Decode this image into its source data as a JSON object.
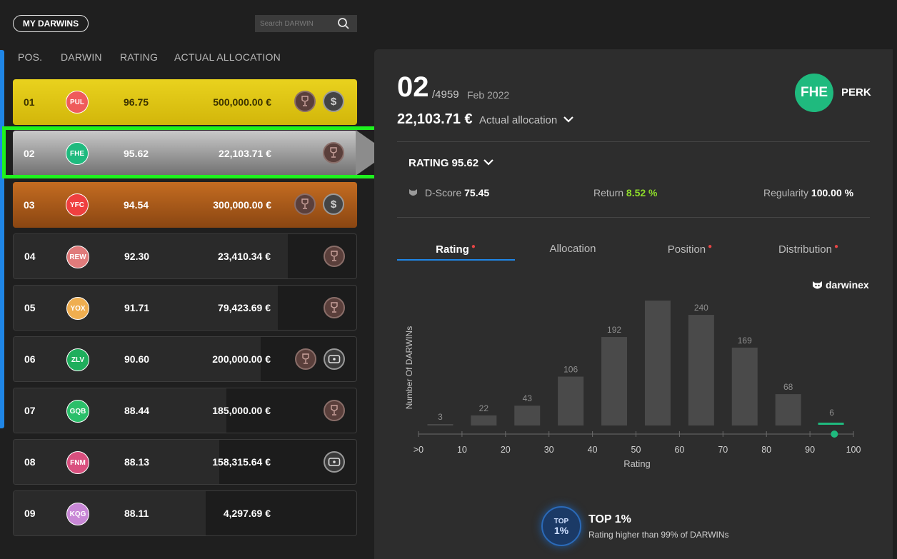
{
  "header": {
    "my_darwins_label": "MY DARWINS",
    "search_placeholder": "Search DARWIN"
  },
  "columns": [
    "POS.",
    "DARWIN",
    "RATING",
    "ACTUAL ALLOCATION"
  ],
  "rows": [
    {
      "pos": "01",
      "darwin": "PUL",
      "rating": "96.75",
      "allocation": "500,000.00 €",
      "avatar_color": "#ef5b5b",
      "alloc_fill": 1.0,
      "medals": [
        "trophy-icon",
        "dollar-icon"
      ]
    },
    {
      "pos": "02",
      "darwin": "FHE",
      "rating": "95.62",
      "allocation": "22,103.71 €",
      "avatar_color": "#1fba7e",
      "alloc_fill": 1.0,
      "medals": [
        "trophy-icon"
      ]
    },
    {
      "pos": "03",
      "darwin": "YFC",
      "rating": "94.54",
      "allocation": "300,000.00 €",
      "avatar_color": "#ef3f3f",
      "alloc_fill": 1.0,
      "medals": [
        "trophy-icon",
        "dollar-icon"
      ]
    },
    {
      "pos": "04",
      "darwin": "REW",
      "rating": "92.30",
      "allocation": "23,410.34 €",
      "avatar_color": "#e07b7b",
      "alloc_fill": 0.8,
      "medals": [
        "trophy-icon"
      ]
    },
    {
      "pos": "05",
      "darwin": "YOX",
      "rating": "91.71",
      "allocation": "79,423.69 €",
      "avatar_color": "#efae50",
      "alloc_fill": 0.77,
      "medals": [
        "trophy-icon"
      ]
    },
    {
      "pos": "06",
      "darwin": "ZLV",
      "rating": "90.60",
      "allocation": "200,000.00 €",
      "avatar_color": "#1fae5c",
      "alloc_fill": 0.72,
      "medals": [
        "trophy-icon",
        "wallet-icon"
      ]
    },
    {
      "pos": "07",
      "darwin": "GQB",
      "rating": "88.44",
      "allocation": "185,000.00 €",
      "avatar_color": "#2bbf6a",
      "alloc_fill": 0.62,
      "medals": [
        "trophy-icon"
      ]
    },
    {
      "pos": "08",
      "darwin": "FNM",
      "rating": "88.13",
      "allocation": "158,315.64 €",
      "avatar_color": "#d94f7e",
      "alloc_fill": 0.6,
      "medals": [
        "wallet-icon"
      ]
    },
    {
      "pos": "09",
      "darwin": "KQG",
      "rating": "88.11",
      "allocation": "4,297.69 €",
      "avatar_color": "#c887d6",
      "alloc_fill": 0.56,
      "medals": []
    }
  ],
  "detail": {
    "position": "02",
    "total": "/4959",
    "date": "Feb 2022",
    "allocation": "22,103.71 €",
    "allocation_label": "Actual allocation",
    "darwin": "FHE",
    "darwin_color": "#1fba7e",
    "name": "PERK",
    "rating_title": "RATING 95.62",
    "dscore_label": "D-Score",
    "dscore_value": "75.45",
    "return_label": "Return",
    "return_value": "8.52 %",
    "regularity_label": "Regularity",
    "regularity_value": "100.00 %",
    "tabs": [
      "Rating",
      "Allocation",
      "Position",
      "Distribution"
    ],
    "brand": "darwinex",
    "top_badge_line1": "TOP",
    "top_badge_line2": "1%",
    "top_title": "TOP 1%",
    "top_sub": "Rating higher than 99% of DARWINs"
  },
  "chart_data": {
    "type": "bar",
    "categories": [
      "0-10",
      "10-20",
      "20-30",
      "30-40",
      "40-50",
      "50-60",
      "60-70",
      "70-80",
      "80-90",
      "90-100"
    ],
    "values": [
      3,
      22,
      43,
      106,
      192,
      271,
      240,
      169,
      68,
      6
    ],
    "highlight_index": 9,
    "marker_value": 95.62,
    "xlabel": "Rating",
    "ylabel": "Number Of DARWINs",
    "x_ticks": [
      ">0",
      "10",
      "20",
      "30",
      "40",
      "50",
      "60",
      "70",
      "80",
      "90",
      "100"
    ],
    "ylim": [
      0,
      271
    ],
    "grid": false,
    "bar_color": "#4a4a4a",
    "highlight_color": "#1fba7e"
  }
}
